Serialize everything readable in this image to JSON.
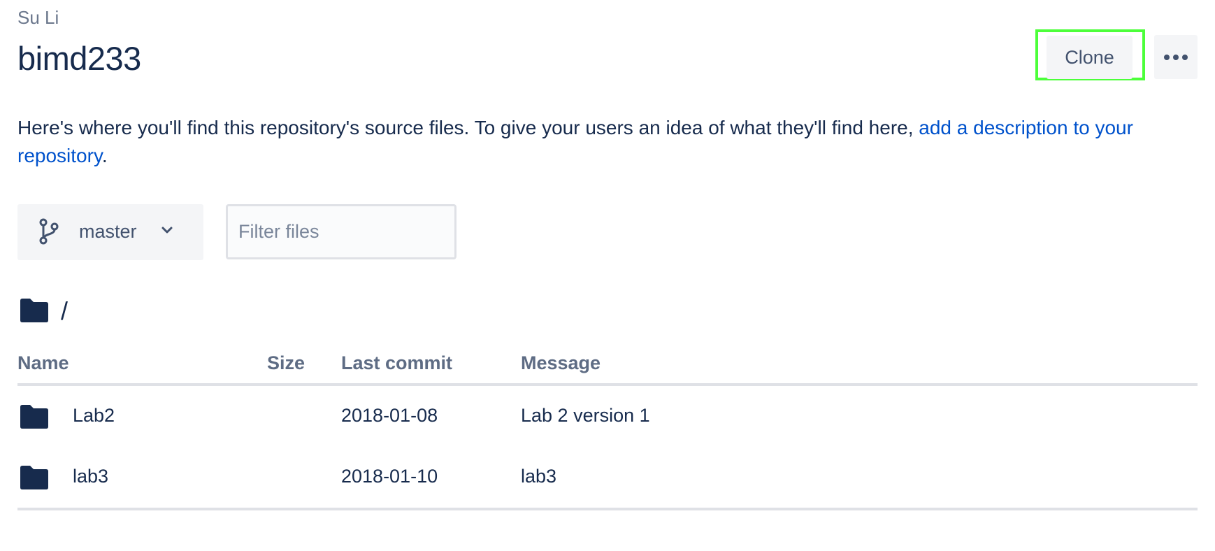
{
  "header": {
    "owner": "Su Li",
    "repo_name": "bimd233",
    "clone_label": "Clone",
    "more_icon": "more-horizontal-icon"
  },
  "description": {
    "text": "Here's where you'll find this repository's source files. To give your users an idea of what they'll find here, ",
    "link_text": "add a description to your repository",
    "suffix": "."
  },
  "toolbar": {
    "branch": "master",
    "branch_icon": "branch-icon",
    "filter_placeholder": "Filter files"
  },
  "path": {
    "icon": "folder-icon",
    "label": "/"
  },
  "table": {
    "columns": [
      "Name",
      "Size",
      "Last commit",
      "Message"
    ],
    "rows": [
      {
        "icon": "folder-icon",
        "name": "Lab2",
        "size": "",
        "last_commit": "2018-01-08",
        "message": "Lab 2 version 1"
      },
      {
        "icon": "folder-icon",
        "name": "lab3",
        "size": "",
        "last_commit": "2018-01-10",
        "message": "lab3"
      }
    ]
  },
  "colors": {
    "text": "#172b4d",
    "link": "#0052cc",
    "secondary": "#6b778c",
    "highlight": "#4cff3a",
    "button_bg": "#f4f5f7"
  }
}
